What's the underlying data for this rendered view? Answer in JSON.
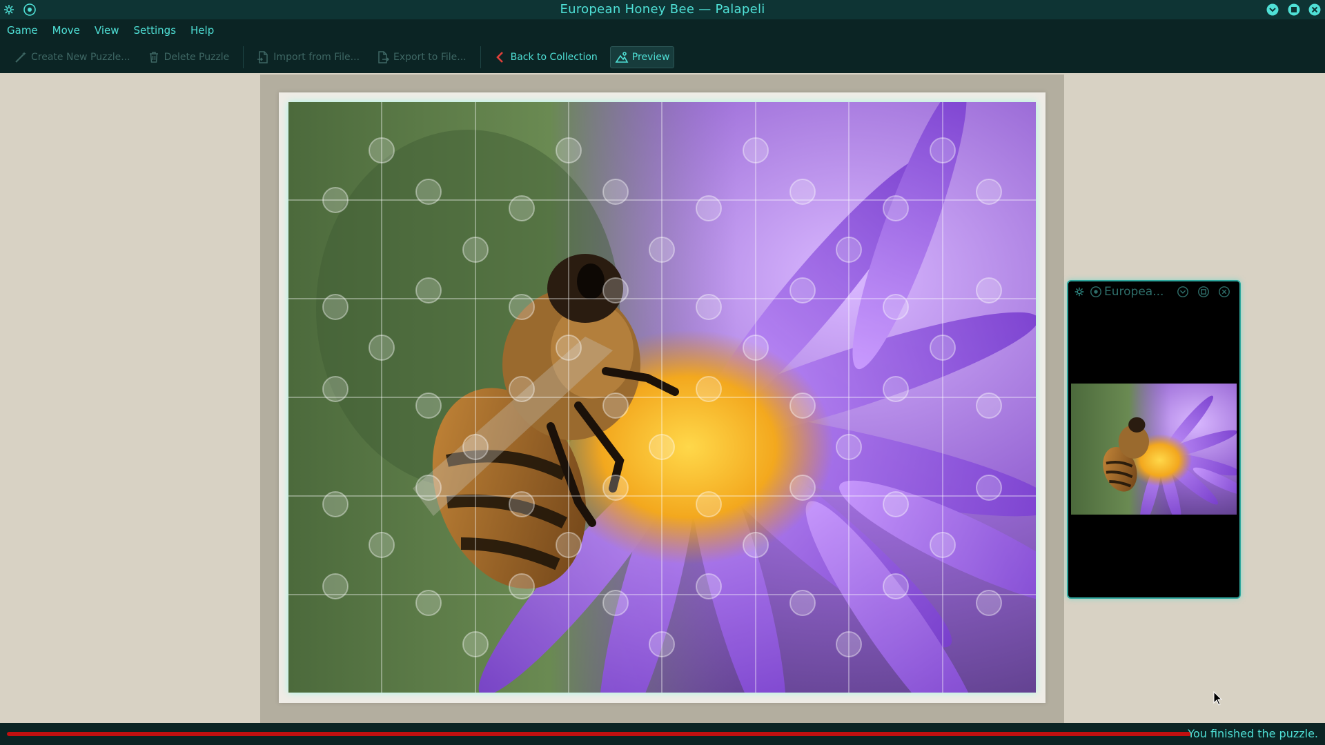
{
  "window": {
    "title": "European Honey Bee — Palapeli"
  },
  "menu": {
    "items": [
      "Game",
      "Move",
      "View",
      "Settings",
      "Help"
    ]
  },
  "toolbar": {
    "create_label": "Create New Puzzle...",
    "delete_label": "Delete Puzzle",
    "import_label": "Import from File...",
    "export_label": "Export to File...",
    "back_label": "Back to Collection",
    "preview_label": "Preview"
  },
  "preview_window": {
    "title": "Europea..."
  },
  "status": {
    "text": "You finished the puzzle.",
    "progress_percent": 100
  },
  "colors": {
    "accent": "#4fe0d6",
    "titlebar_bg": "#0e3434",
    "toolbar_bg": "#0b2424",
    "progress_fill": "#c01010"
  },
  "icons": {
    "app": "gear-app-icon",
    "pin": "pin-icon",
    "minimize": "chevron-down-circle-icon",
    "maximize": "square-icon",
    "close": "close-circle-icon"
  }
}
